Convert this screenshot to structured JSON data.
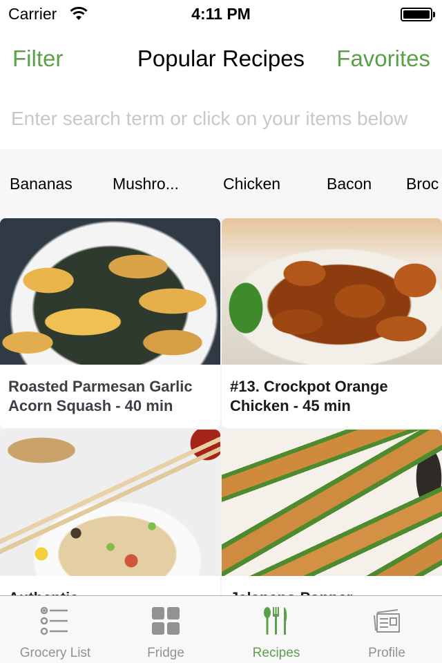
{
  "status_bar": {
    "carrier": "Carrier",
    "time": "4:11 PM",
    "battery_level": 1.0
  },
  "nav": {
    "left_label": "Filter",
    "title": "Popular Recipes",
    "right_label": "Favorites"
  },
  "search": {
    "value": "",
    "placeholder": "Enter search term or click on your items below"
  },
  "ingredients": [
    {
      "label": "Bananas"
    },
    {
      "label": "Mushro..."
    },
    {
      "label": "Chicken"
    },
    {
      "label": "Bacon"
    },
    {
      "label": "Broc"
    }
  ],
  "recipes": [
    {
      "title": "Roasted Parmesan Garlic Acorn Squash - 40 min",
      "image": "roasted acorn squash slices on a plate"
    },
    {
      "title": "#13. Crockpot Orange Chicken - 45 min",
      "image": "orange chicken with broccoli on a plate"
    },
    {
      "title": "Authentic ...",
      "image": "fried rice with chopsticks"
    },
    {
      "title": "Jalapeno Popper ...",
      "image": "stuffed jalapeno poppers"
    }
  ],
  "tab_bar": {
    "active_color": "#5aa04b",
    "inactive_color": "#929292",
    "tabs": [
      {
        "label": "Grocery List",
        "icon": "list-icon",
        "active": false
      },
      {
        "label": "Fridge",
        "icon": "grid-icon",
        "active": false
      },
      {
        "label": "Recipes",
        "icon": "utensils-icon",
        "active": true
      },
      {
        "label": "Profile",
        "icon": "newspaper-icon",
        "active": false
      }
    ]
  },
  "colors": {
    "accent": "#5aa04b",
    "placeholder": "#c7c7cd",
    "strip_background": "#f7f7f7"
  }
}
